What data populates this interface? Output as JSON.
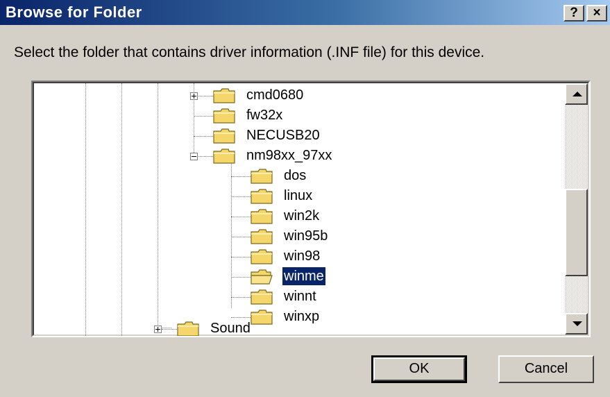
{
  "window": {
    "title": "Browse for Folder",
    "help_label": "?",
    "close_label": "×"
  },
  "prompt": "Select the folder that contains driver information (.INF file) for this device.",
  "tree": {
    "items": [
      {
        "label": "cmd0680",
        "expander": "plus",
        "icon": "folder-closed-icon"
      },
      {
        "label": "fw32x",
        "expander": "none",
        "icon": "folder-closed-icon"
      },
      {
        "label": "NECUSB20",
        "expander": "none",
        "icon": "folder-closed-icon"
      },
      {
        "label": "nm98xx_97xx",
        "expander": "minus",
        "icon": "folder-closed-icon"
      },
      {
        "label": "dos",
        "icon": "folder-closed-icon"
      },
      {
        "label": "linux",
        "icon": "folder-closed-icon"
      },
      {
        "label": "win2k",
        "icon": "folder-closed-icon"
      },
      {
        "label": "win95b",
        "icon": "folder-closed-icon"
      },
      {
        "label": "win98",
        "icon": "folder-closed-icon"
      },
      {
        "label": "winme",
        "icon": "folder-open-icon",
        "selected": true
      },
      {
        "label": "winnt",
        "icon": "folder-closed-icon"
      },
      {
        "label": "winxp",
        "icon": "folder-closed-icon"
      },
      {
        "label": "Sound",
        "expander": "plus",
        "icon": "folder-closed-icon"
      }
    ]
  },
  "buttons": {
    "ok": "OK",
    "cancel": "Cancel"
  },
  "colors": {
    "title_bar_start": "#0a246a",
    "title_bar_end": "#a6caf0",
    "selection": "#0a246a",
    "face": "#d4d0c8",
    "folder": "#f5d66b"
  }
}
